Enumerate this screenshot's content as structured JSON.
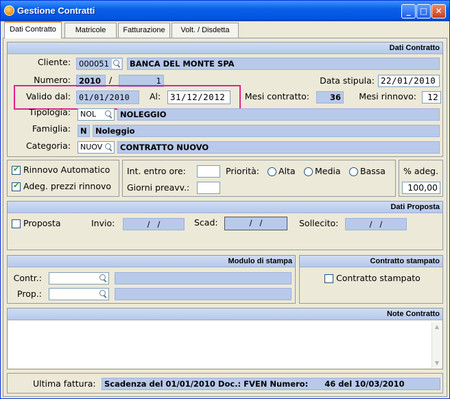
{
  "window": {
    "title": "Gestione Contratti"
  },
  "tabs": [
    "Dati Contratto",
    "Matricole",
    "Fatturazione",
    "Volt. / Disdetta"
  ],
  "dati_contratto": {
    "header": "Dati Contratto",
    "cliente_label": "Cliente:",
    "cliente_code": "000051",
    "cliente_name": "BANCA DEL MONTE SPA",
    "numero_label": "Numero:",
    "numero_anno": "2010",
    "numero_sep": "/",
    "numero_val": "1",
    "data_stipula_label": "Data stipula:",
    "data_stipula": "22/01/2010",
    "valido_dal_label": "Valido dal:",
    "valido_dal": "01/01/2010",
    "al_label": "Al:",
    "al": "31/12/2012",
    "mesi_contratto_label": "Mesi contratto:",
    "mesi_contratto": "36",
    "mesi_rinnovo_label": "Mesi rinnovo:",
    "mesi_rinnovo": "12",
    "tipologia_label": "Tipologia:",
    "tipologia_code": "NOL",
    "tipologia_desc": "NOLEGGIO",
    "famiglia_label": "Famiglia:",
    "famiglia_code": "N",
    "famiglia_desc": "Noleggio",
    "categoria_label": "Categoria:",
    "categoria_code": "NUOV",
    "categoria_desc": "CONTRATTO NUOVO"
  },
  "opzioni": {
    "rinnovo_automatico": "Rinnovo Automatico",
    "adeg_prezzi": "Adeg. prezzi rinnovo",
    "int_entro_ore": "Int. entro ore:",
    "giorni_preavv": "Giorni preavv.:",
    "priorita_label": "Priorità:",
    "priorita": [
      "Alta",
      "Media",
      "Bassa"
    ],
    "adeg_label": "% adeg.",
    "adeg_value": "100,00"
  },
  "dati_proposta": {
    "header": "Dati Proposta",
    "proposta": "Proposta",
    "invio_label": "Invio:",
    "invio": " /   / ",
    "scad_label": "Scad:",
    "scad": " /   / ",
    "sollecito_label": "Sollecito:",
    "sollecito": " /   / "
  },
  "modulo_stampa": {
    "header": "Modulo di stampa",
    "contr_label": "Contr.:",
    "prop_label": "Prop.:"
  },
  "contratto_stampato": {
    "header": "Contratto stampato",
    "checkbox": "Contratto stampato"
  },
  "note": {
    "header": "Note Contratto"
  },
  "footer": {
    "ultima_fattura_label": "Ultima fattura:",
    "ultima_fattura": "Scadenza del 01/01/2010 Doc.: FVEN Numero:      46 del 10/03/2010"
  }
}
